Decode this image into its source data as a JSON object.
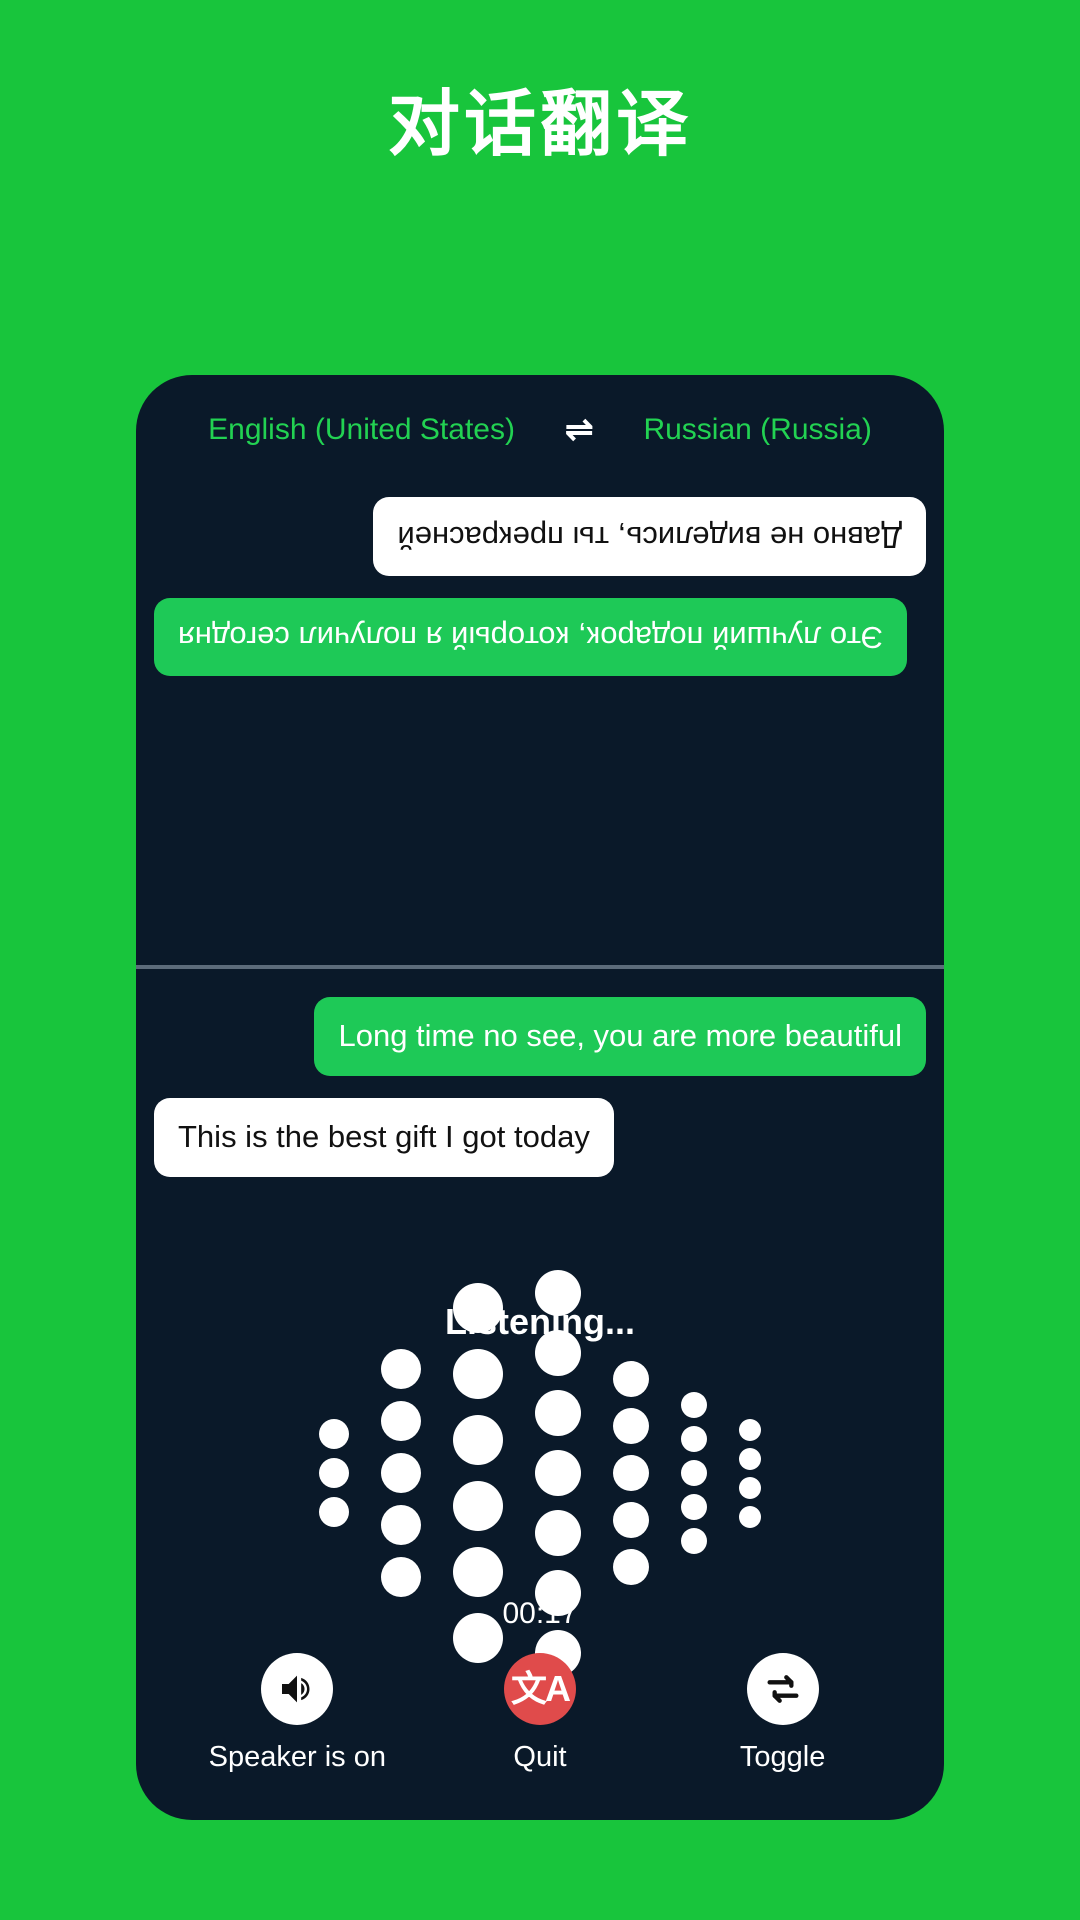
{
  "page": {
    "title": "对话翻译",
    "background_color": "#18C53C",
    "panel_color": "#0A1929",
    "accent_green": "#1EC957",
    "lang_text_color": "#22D252",
    "quit_color": "#E04B4B"
  },
  "language_bar": {
    "source": "English (United States)",
    "target": "Russian (Russia)",
    "swap_icon": "swap-horizontal-icon",
    "swap_glyph": "⇌"
  },
  "conversation": {
    "remote_pane": {
      "rotated": true,
      "messages": [
        {
          "text": "Это лучший подарок, который я получил сегодня",
          "style": "green",
          "align": "right"
        },
        {
          "text": "Давно не виделись, ты прекрасней",
          "style": "white",
          "align": "left"
        }
      ]
    },
    "local_pane": {
      "rotated": false,
      "messages": [
        {
          "text": "Long time no see, you are more beautiful",
          "style": "green",
          "align": "right"
        },
        {
          "text": "This is the best gift I got today",
          "style": "white",
          "align": "left"
        }
      ]
    }
  },
  "listening": {
    "label": "Listening...",
    "timer": "00:17",
    "waveform": {
      "dot_color": "#FFFFFF",
      "columns": [
        {
          "count": 3,
          "size": 15
        },
        {
          "count": 5,
          "size": 20
        },
        {
          "count": 6,
          "size": 25
        },
        {
          "count": 7,
          "size": 23
        },
        {
          "count": 5,
          "size": 18
        },
        {
          "count": 5,
          "size": 13
        },
        {
          "count": 4,
          "size": 11
        }
      ]
    }
  },
  "controls": [
    {
      "label": "Speaker is on",
      "icon": "speaker-on-icon",
      "circle": "white"
    },
    {
      "label": "Quit",
      "icon": "translate-icon",
      "circle": "red",
      "glyph": "文A"
    },
    {
      "label": "Toggle",
      "icon": "repeat-icon",
      "circle": "white"
    }
  ]
}
